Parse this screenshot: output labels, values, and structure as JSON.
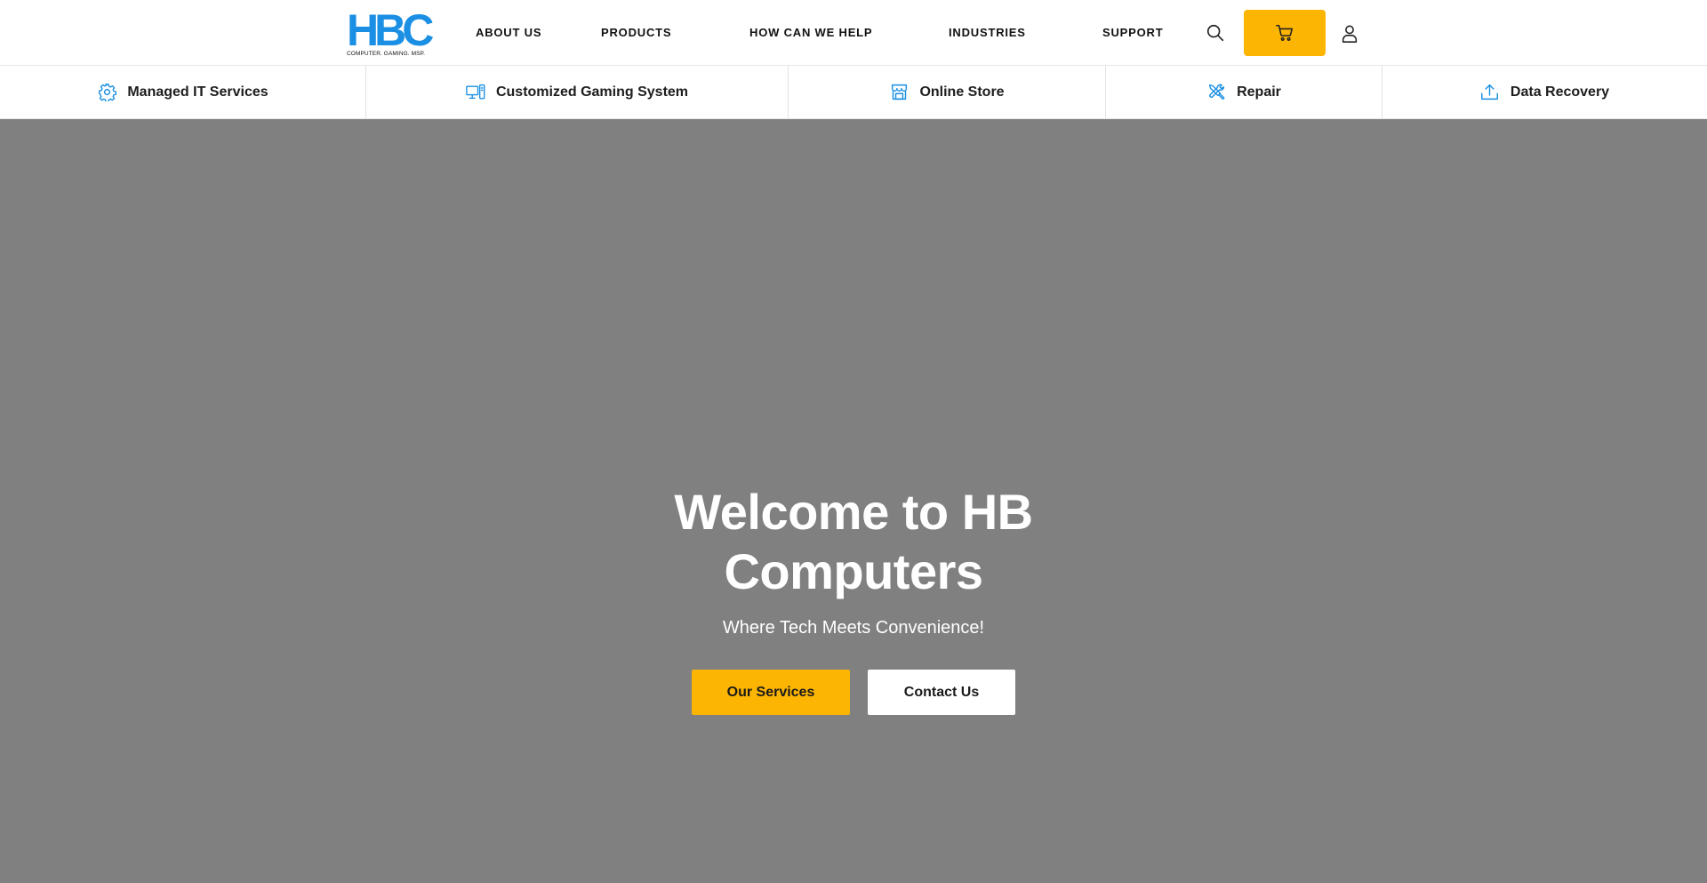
{
  "brand": {
    "logo_text": "HBC",
    "tagline": "COMPUTER.  GAMING.  MSP.",
    "primary_color": "#1a8fe3",
    "accent_color": "#fdb503"
  },
  "nav": {
    "items": [
      {
        "label": "ABOUT US"
      },
      {
        "label": "PRODUCTS"
      },
      {
        "label": "HOW CAN WE HELP"
      },
      {
        "label": "INDUSTRIES"
      },
      {
        "label": "SUPPORT"
      }
    ],
    "icons": {
      "search": "search-icon",
      "cart": "cart-icon",
      "account": "user-icon"
    }
  },
  "categories": [
    {
      "label": "Managed IT Services",
      "icon": "gear-icon"
    },
    {
      "label": "Customized Gaming System",
      "icon": "desktop-computer-icon"
    },
    {
      "label": "Online Store",
      "icon": "storefront-icon"
    },
    {
      "label": "Repair",
      "icon": "tools-icon"
    },
    {
      "label": "Data Recovery",
      "icon": "upload-icon"
    }
  ],
  "hero": {
    "title_line1": "Welcome to HB",
    "title_line2": "Computers",
    "subtitle": "Where Tech Meets Convenience!",
    "primary_cta": "Our Services",
    "secondary_cta": "Contact Us",
    "background_color": "#808080"
  }
}
